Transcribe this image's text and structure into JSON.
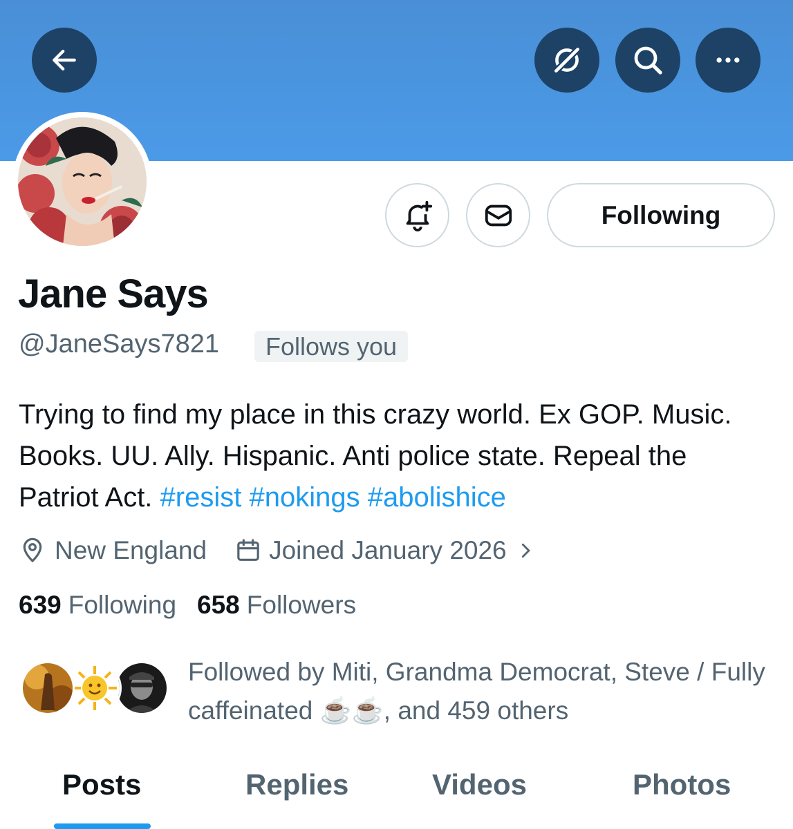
{
  "header": {
    "back_icon": "arrow-left-icon",
    "grok_icon": "grok-icon",
    "search_icon": "search-icon",
    "more_icon": "more-horizontal-icon",
    "banner_color": "#4b9ae8"
  },
  "profile": {
    "display_name": "Jane Says",
    "handle": "@JaneSays7821",
    "follows_you": "Follows you",
    "bio_text": "Trying to find my place in this crazy world. Ex GOP. Music. Books. UU. Ally. Hispanic. Anti police state. Repeal the Patriot Act.",
    "hashtags": [
      "#resist",
      "#nokings",
      "#abolishice"
    ],
    "location": "New England",
    "joined": "Joined January 2026",
    "following_count": "639",
    "following_label": "Following",
    "followers_count": "658",
    "followers_label": "Followers"
  },
  "actions": {
    "notify_icon": "bell-plus-icon",
    "message_icon": "envelope-icon",
    "following_button": "Following"
  },
  "followed_by": {
    "text": "Followed by Miti, Grandma Democrat, Steve / Fully caffeinated ☕️☕️, and 459 others"
  },
  "tabs": [
    {
      "label": "Posts",
      "active": true
    },
    {
      "label": "Replies",
      "active": false
    },
    {
      "label": "Videos",
      "active": false
    },
    {
      "label": "Photos",
      "active": false
    }
  ],
  "colors": {
    "link": "#1d9bf0",
    "secondary_text": "#536471",
    "primary_text": "#0f1419"
  }
}
